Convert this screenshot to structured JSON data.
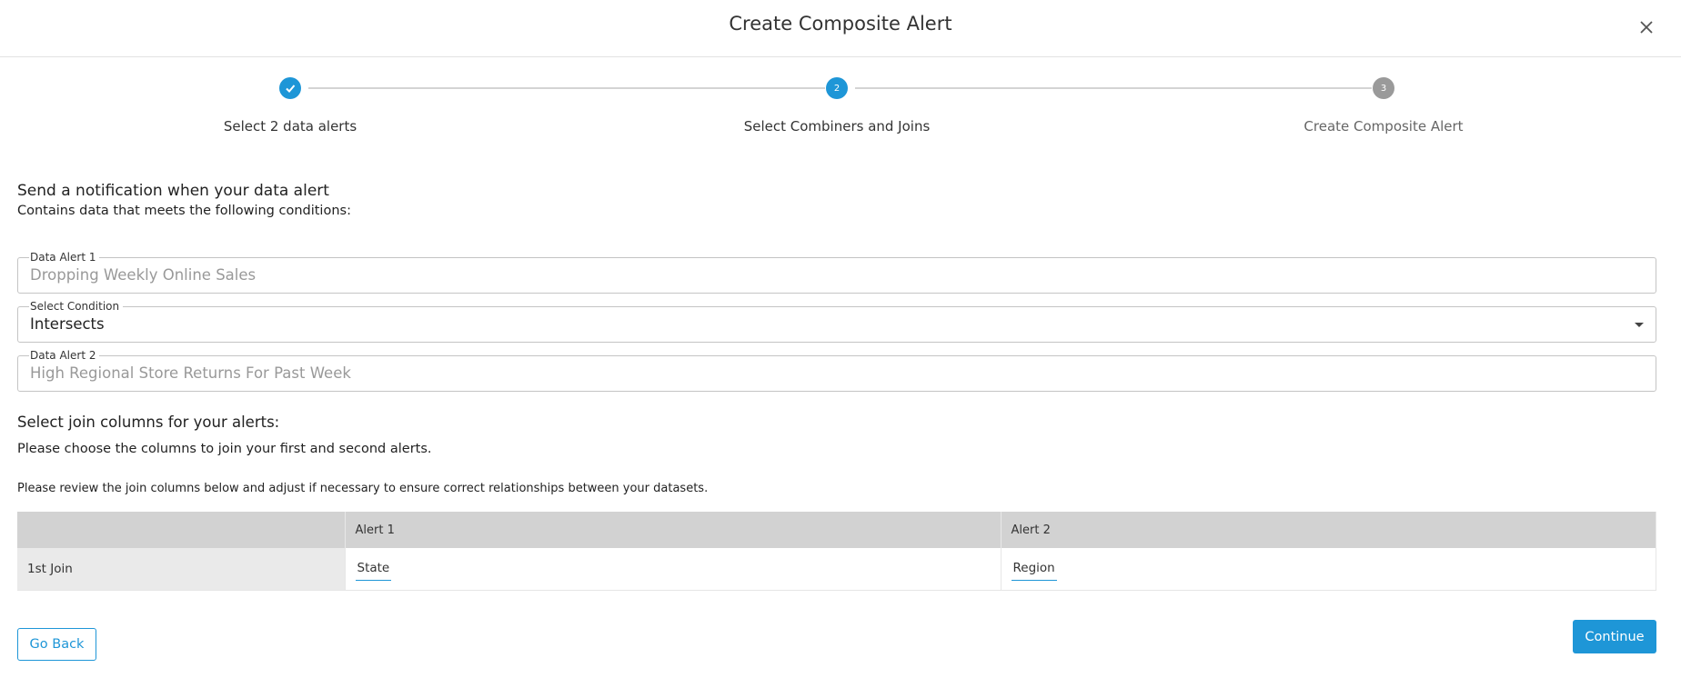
{
  "header": {
    "title": "Create Composite Alert"
  },
  "steps": [
    {
      "number": "1",
      "label": "Select 2 data alerts",
      "status": "done"
    },
    {
      "number": "2",
      "label": "Select Combiners and Joins",
      "status": "active"
    },
    {
      "number": "3",
      "label": "Create Composite Alert",
      "status": "pending"
    }
  ],
  "intro": {
    "title": "Send a notification when your data alert",
    "subtitle": "Contains data that meets the following conditions:"
  },
  "fields": {
    "alert1": {
      "label": "Data Alert 1",
      "value": "Dropping Weekly Online Sales"
    },
    "condition": {
      "label": "Select Condition",
      "value": "Intersects"
    },
    "alert2": {
      "label": "Data Alert 2",
      "value": "High Regional Store Returns For Past Week"
    }
  },
  "join": {
    "title": "Select join columns for your alerts:",
    "subtitle": "Please choose the columns to join your first and second alerts.",
    "note": "Please review the join columns below and adjust if necessary to ensure correct relationships between your datasets.",
    "headers": [
      "",
      "Alert 1",
      "Alert 2"
    ],
    "rows": [
      {
        "label": "1st Join",
        "alert1": "State",
        "alert2": "Region"
      }
    ]
  },
  "footer": {
    "back_label": "Go Back",
    "continue_label": "Continue"
  },
  "colors": {
    "accent": "#1e96d7",
    "pending": "#9a9a9a",
    "table_header": "#d2d2d2"
  }
}
